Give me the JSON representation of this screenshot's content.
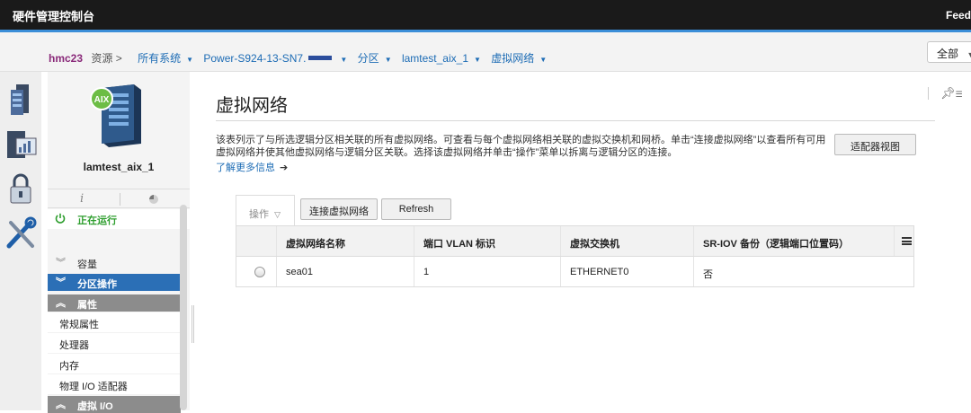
{
  "app": {
    "title": "硬件管理控制台",
    "feedback": "Feed"
  },
  "breadcrumb": {
    "host": "hmc23",
    "resources": "资源 >",
    "all_systems": "所有系统",
    "system_prefix": "Power-S924-13-SN7",
    "system_suffix": ".",
    "partition": "分区",
    "lpar": "lamtest_aix_1",
    "current": "虚拟网络"
  },
  "scope": {
    "value": "全部"
  },
  "side_panel": {
    "server_badge": "AIX",
    "lpar_name": "lamtest_aix_1",
    "status_text": "正在运行",
    "sections": {
      "capacity": "容量",
      "partition_actions": "分区操作",
      "properties": "属性",
      "virtual_io": "虚拟 I/O"
    },
    "property_items": [
      "常规属性",
      "处理器",
      "内存",
      "物理 I/O 适配器"
    ]
  },
  "main": {
    "title": "虚拟网络",
    "description": "该表列示了与所选逻辑分区相关联的所有虚拟网络。可查看与每个虚拟网络相关联的虚拟交换机和网桥。单击“连接虚拟网络”以查看所有可用虚拟网络并使其他虚拟网络与逻辑分区关联。选择该虚拟网络并单击“操作”菜单以拆离与逻辑分区的连接。",
    "learn_more": "了解更多信息",
    "adapter_view_button": "适配器视图",
    "actions_menu": "操作",
    "connect_button": "连接虚拟网络",
    "refresh_button": "Refresh"
  },
  "table": {
    "columns": [
      "虚拟网络名称",
      "端口 VLAN 标识",
      "虚拟交换机",
      "SR-IOV 备份（逻辑端口位置码）"
    ],
    "rows": [
      {
        "name": "sea01",
        "vlan": "1",
        "vswitch": "ETHERNET0",
        "sriov_backup": "否"
      }
    ]
  },
  "colors": {
    "topbar": "#1a1a1a",
    "accent_blue": "#2b6fb6",
    "link": "#1d6cb5",
    "running_green": "#2e9e2e"
  }
}
